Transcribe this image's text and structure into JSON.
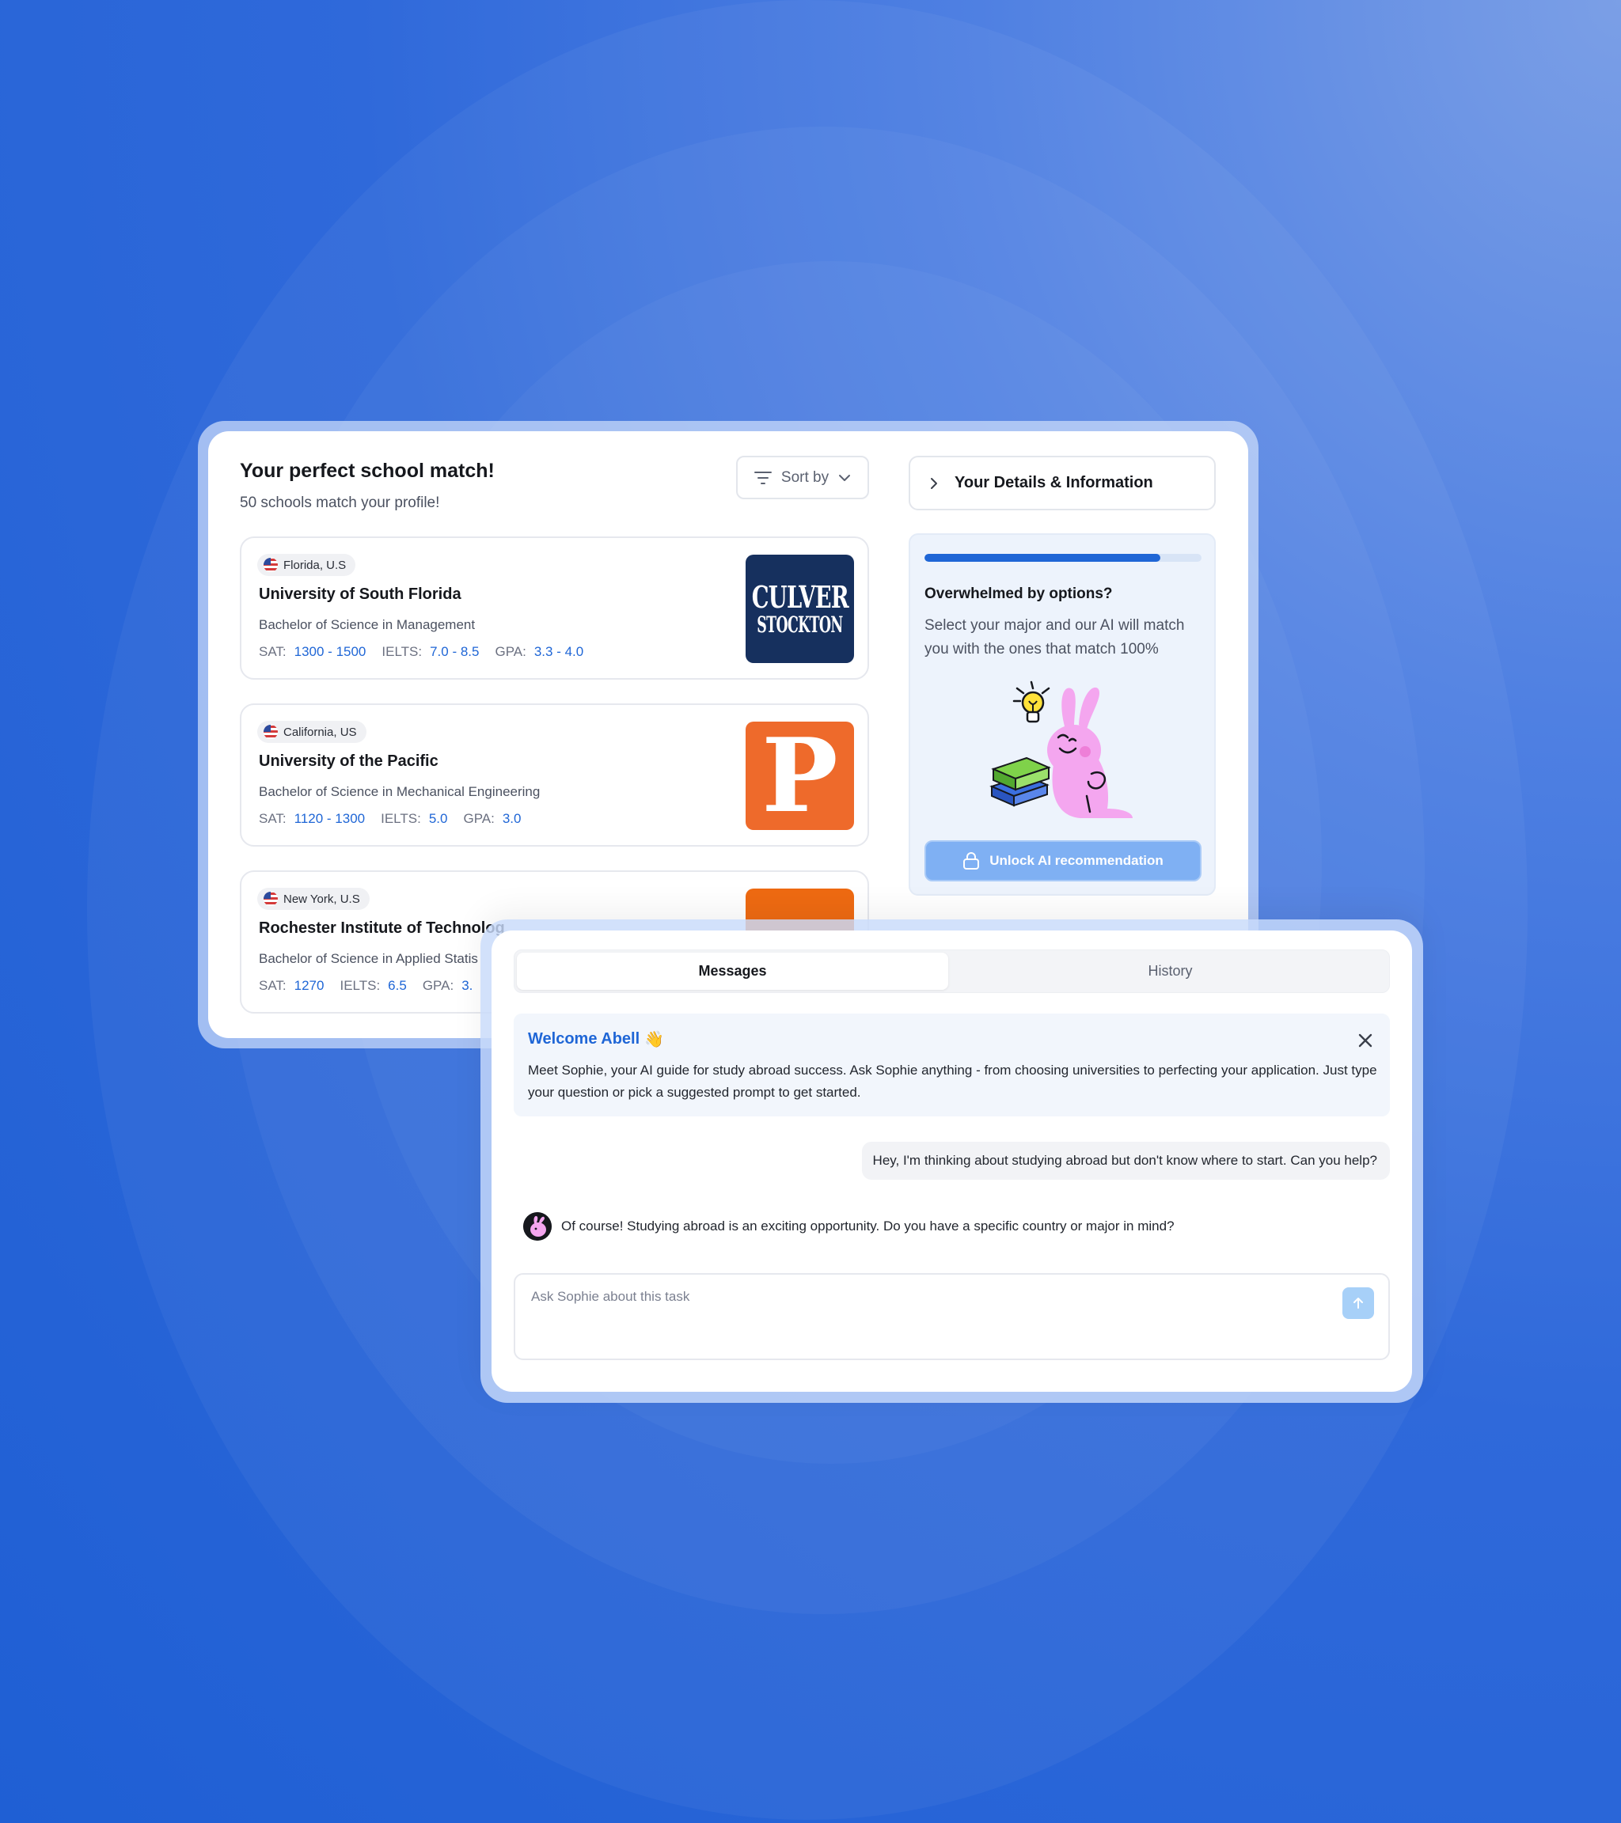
{
  "school_match": {
    "title": "Your perfect school match!",
    "subtitle": "50 schools match your profile!",
    "sort_label": "Sort by",
    "schools": [
      {
        "location": "Florida, U.S",
        "name": "University of South Florida",
        "degree": "Bachelor of Science in Management",
        "sat_label": "SAT:",
        "sat": "1300 - 1500",
        "ielts_label": "IELTS:",
        "ielts": "7.0 - 8.5",
        "gpa_label": "GPA:",
        "gpa": "3.3 - 4.0",
        "logo_line1": "CULVER",
        "logo_line2": "STOCKTON"
      },
      {
        "location": "California, US",
        "name": "University of the Pacific",
        "degree": "Bachelor of Science in Mechanical Engineering",
        "sat_label": "SAT:",
        "sat": "1120 - 1300",
        "ielts_label": "IELTS:",
        "ielts": "5.0",
        "gpa_label": "GPA:",
        "gpa": "3.0",
        "logo_letter": "P"
      },
      {
        "location": "New York, U.S",
        "name": "Rochester Institute of Technolog",
        "degree": "Bachelor of Science in Applied Statis",
        "sat_label": "SAT:",
        "sat": "1270",
        "ielts_label": "IELTS:",
        "ielts": "6.5",
        "gpa_label": "GPA:",
        "gpa": "3."
      }
    ]
  },
  "details": {
    "button_label": "Your Details & Information"
  },
  "ai_panel": {
    "progress_percent": 85,
    "title": "Overwhelmed by options?",
    "text": "Select your major and our AI will match you with the ones that match 100%",
    "unlock_label": "Unlock AI recommendation"
  },
  "chat": {
    "tabs": [
      "Messages",
      "History"
    ],
    "welcome_title": "Welcome Abell",
    "welcome_emoji": "👋",
    "welcome_body": "Meet Sophie, your AI guide for study abroad success. Ask Sophie anything - from choosing universities to perfecting your application. Just type your question or pick a suggested prompt to get started.",
    "user_message": "Hey, I'm thinking about studying abroad but don't know where to start. Can you help?",
    "bot_message": "Of course! Studying abroad is an exciting opportunity. Do you have a specific country or major in mind?",
    "input_placeholder": "Ask Sophie about this task"
  },
  "colors": {
    "accent": "#1f66d6",
    "background": "#2463d6",
    "unlock_button": "#7fb0f3",
    "culver_logo": "#16305e",
    "pacific_logo": "#ee6a2b"
  }
}
